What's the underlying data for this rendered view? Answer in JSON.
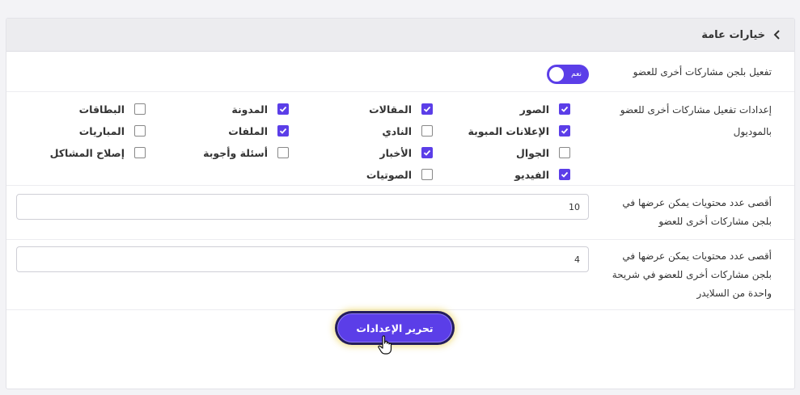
{
  "header": {
    "title": "خيارات عامة"
  },
  "enable_row": {
    "label": "تفعيل بلجن مشاركات أخرى للعضو",
    "toggle_text": "نعم",
    "toggle_on": true
  },
  "modules_row": {
    "label": "إعدادات تفعيل مشاركات أخرى للعضو بالموديول",
    "items": [
      {
        "label": "الصور",
        "checked": true
      },
      {
        "label": "المقالات",
        "checked": true
      },
      {
        "label": "المدونة",
        "checked": true
      },
      {
        "label": "البطاقات",
        "checked": false
      },
      {
        "label": "الإعلانات المبوبة",
        "checked": true
      },
      {
        "label": "النادي",
        "checked": false
      },
      {
        "label": "الملفات",
        "checked": true
      },
      {
        "label": "المباريات",
        "checked": false
      },
      {
        "label": "الجوال",
        "checked": false
      },
      {
        "label": "الأخبار",
        "checked": true
      },
      {
        "label": "أسئلة وأجوبة",
        "checked": false
      },
      {
        "label": "إصلاح المشاكل",
        "checked": false
      },
      {
        "label": "الفيديو",
        "checked": true
      },
      {
        "label": "الصوتيات",
        "checked": false
      }
    ]
  },
  "max_row": {
    "label": "أقصى عدد محتويات يمكن عرضها في بلجن مشاركات أخرى للعضو",
    "value": "10"
  },
  "slider_row": {
    "label": "أقصى عدد محتويات يمكن عرضها في بلجن مشاركات أخرى للعضو في شريحة واحدة من السلايدر",
    "value": "4"
  },
  "submit": {
    "label": "تحرير الإعدادات"
  },
  "colors": {
    "accent": "#5b3ee8",
    "header_bg": "#ececef"
  }
}
